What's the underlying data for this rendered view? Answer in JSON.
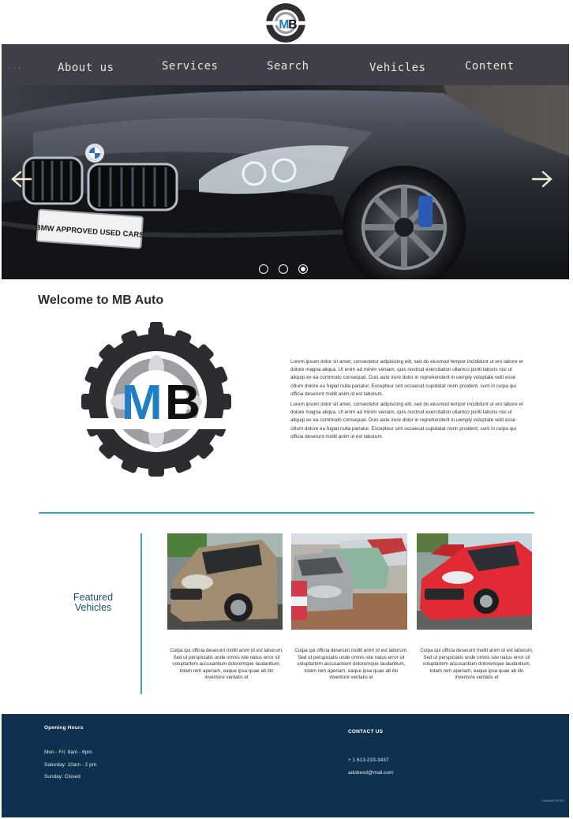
{
  "logo": {
    "letters": "MB"
  },
  "nav": {
    "dots": "...",
    "items": [
      {
        "label": "About us"
      },
      {
        "label": "Services"
      },
      {
        "label": "Search"
      },
      {
        "label": "Vehicles"
      },
      {
        "label": "Content"
      }
    ]
  },
  "hero": {
    "plate_text": "BMW APPROVED USED CARS",
    "slide_count": 3,
    "active_slide": 3,
    "left_arrow": "arrow-left-icon",
    "right_arrow": "arrow-right-icon"
  },
  "welcome": {
    "title": "Welcome to MB Auto",
    "paragraphs": [
      "Lorem ipsum dolor sit amet, consectetur adipisicing elit, sed do eiusmod tempor incididunt ut ero labore et dolore magna aliqua. Ut enim ad minim veniam, quis nostrud exercitation ullamco poriti laboris nisi ut aliquip ex ea commodo consequat. Duis aute irure dolor in reprehenderit in uienply voluptate velit esse cillum dolore eu fugiat nulla pariatur. Excepteur sint occaecat cupidatat norin proident, sunt in culpa qui officia deserunt mollit anim id est laborum.",
      "Lorem ipsum dolor sit amet, consectetur adipisicing elit, sed do eiusmod tempor incididunt ut ero labore et dolore magna aliqua. Ut enim ad minim veniam, quis nostrud exercitation ullamco poriti laboris nisi ut aliquip ex ea commodo consequat. Duis aute irure dolor in reprehenderit in uienply voluptate velit esse cillum dolore eu fugiat nulla pariatur. Excepteur sint occaecat cupidatat norin proident, sunt in culpa qui officia deserunt mollit anim id est laborum."
    ]
  },
  "featured": {
    "label_line1": "Featured",
    "label_line2": "Vehicles",
    "vehicles": [
      {
        "caption": "Culpa qui officia deserunt mollit anim id est laborum. Sed ut perspiciatis unde omnis iste natus error sit voluptartem accusantium doloremque laudantium, totam rem aperiam, eaque ipsa quae ab illo inventore veritatis et"
      },
      {
        "caption": "Culpa qui officia deserunt mollit anim id est laborum. Sed ut perspiciatis unde omnis iste natus error sit voluptartem accusantium doloremque laudantium, totam rem aperiam, eaque ipsa quae ab illo inventore veritatis et"
      },
      {
        "caption": "Culpa qui officia deserunt mollit anim id est laborum. Sed ut perspiciatis unde omnis iste natus error sit voluptartem accusantium doloremque laudantium, totam rem aperiam, eaque ipsa quae ab illo inventore veritatis et"
      }
    ]
  },
  "footer": {
    "hours_title": "Opening Hours",
    "hours": [
      "Mon - Fri: 8am - 6pm",
      "Saturday: 10am - 2 pm",
      "Sunday: Closed"
    ],
    "contact_title": "CONTACT US",
    "phone": "+ 1 613-233-3437",
    "email": "adobexd@mail.com",
    "copyright": "© AdobeXD Kit 2017"
  },
  "colors": {
    "nav_bg": "#3f3e49",
    "nav_text": "#e8e6d6",
    "accent_blue": "#3ea2d6",
    "logo_blue": "#1f7fc4",
    "footer_bg": "#0f3150",
    "featured_text": "#1c4f74"
  }
}
